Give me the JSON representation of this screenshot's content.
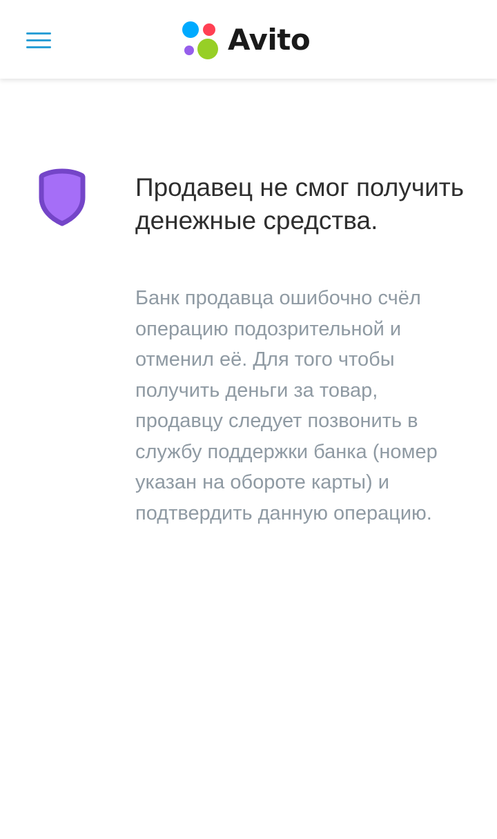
{
  "header": {
    "logo_text": "Avito",
    "menu_icon": "hamburger-menu-icon",
    "logo_icon": "avito-dots-logo-icon"
  },
  "content": {
    "icon": "shield-icon",
    "title": "Продавец не смог получить денежные средства.",
    "description": "Банк продавца ошибочно счёл операцию подозрительной и отменил её. Для того чтобы получить деньги за товар, продавцу следует позвонить в службу поддержки банка (номер указан на обороте карты) и подтвердить данную операцию."
  },
  "colors": {
    "menu_icon": "#2a9fd6",
    "logo_text": "#1a1a1a",
    "dot_blue": "#00aaff",
    "dot_red": "#ff4053",
    "dot_purple": "#965eeb",
    "dot_green": "#97cf26",
    "shield_fill": "#a56ef7",
    "shield_border": "#7445c8",
    "title_text": "#2e2e2e",
    "description_text": "#8f9aa3"
  }
}
